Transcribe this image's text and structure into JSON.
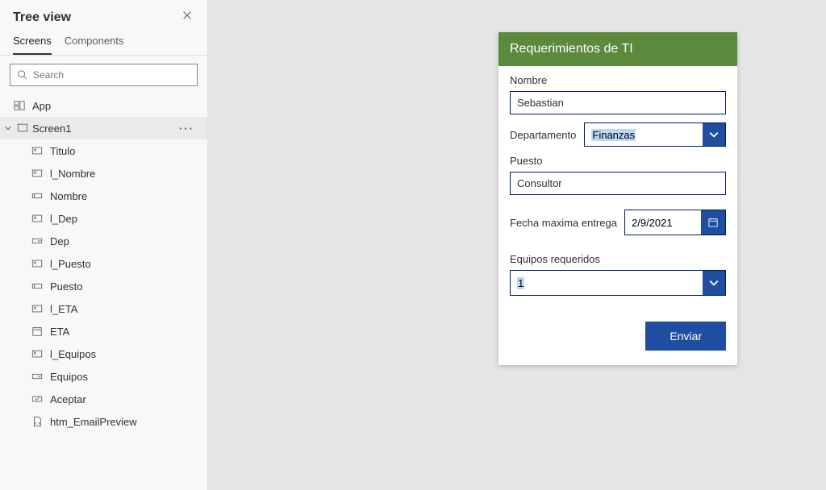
{
  "panel": {
    "title": "Tree view",
    "tabs": {
      "screens": "Screens",
      "components": "Components"
    },
    "search_placeholder": "Search",
    "app_label": "App",
    "screen_label": "Screen1",
    "items": [
      {
        "label": "Titulo",
        "icon": "label"
      },
      {
        "label": "l_Nombre",
        "icon": "label"
      },
      {
        "label": "Nombre",
        "icon": "input"
      },
      {
        "label": "l_Dep",
        "icon": "label"
      },
      {
        "label": "Dep",
        "icon": "dropdown"
      },
      {
        "label": "l_Puesto",
        "icon": "label"
      },
      {
        "label": "Puesto",
        "icon": "input"
      },
      {
        "label": "l_ETA",
        "icon": "label"
      },
      {
        "label": "ETA",
        "icon": "date"
      },
      {
        "label": "l_Equipos",
        "icon": "label"
      },
      {
        "label": "Equipos",
        "icon": "dropdown"
      },
      {
        "label": "Aceptar",
        "icon": "button"
      },
      {
        "label": "htm_EmailPreview",
        "icon": "html"
      }
    ]
  },
  "form": {
    "title": "Requerimientos de TI",
    "nombre_label": "Nombre",
    "nombre_value": "Sebastian",
    "dep_label": "Departamento",
    "dep_value": "Finanzas",
    "puesto_label": "Puesto",
    "puesto_value": "Consultor",
    "fecha_label": "Fecha maxima entrega",
    "fecha_value": "2/9/2021",
    "equipos_label": "Equipos requeridos",
    "equipos_value": "1",
    "send": "Enviar"
  }
}
